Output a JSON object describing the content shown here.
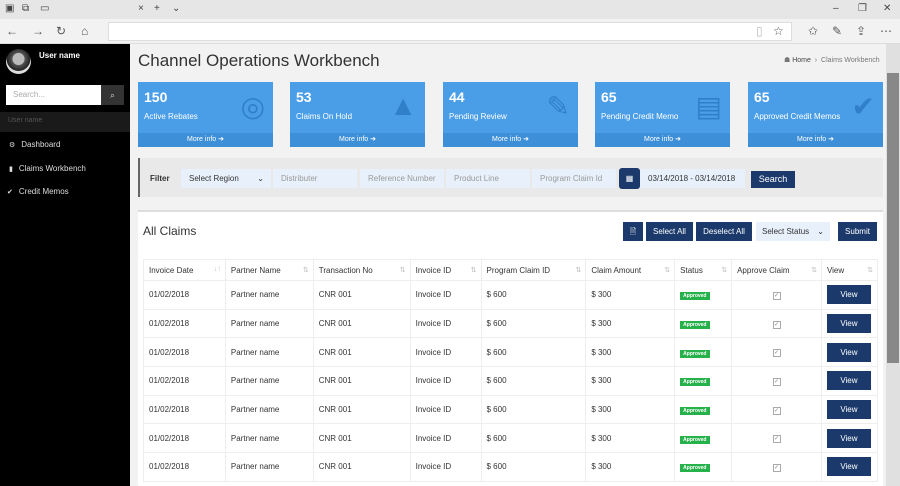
{
  "browser": {
    "tab_icons": [
      "tabs-icon",
      "set-aside-icon",
      "window-icon"
    ],
    "close": "×",
    "new_tab": "+",
    "tab_menu": "⌄",
    "win_min": "–",
    "win_max": "❐",
    "win_close": "✕"
  },
  "sidebar": {
    "username": "User name",
    "search_placeholder": "Search...",
    "section_label": "User name",
    "items": [
      {
        "label": "Dashboard",
        "icon": "dashboard-icon"
      },
      {
        "label": "Claims Workbench",
        "icon": "file-icon"
      },
      {
        "label": "Credit Memos",
        "icon": "check-circle-icon"
      }
    ]
  },
  "header": {
    "title": "Channel Operations Workbench",
    "breadcrumb": [
      "Home",
      "Claims Workbench"
    ]
  },
  "cards": [
    {
      "value": "150",
      "label": "Active Rebates",
      "more": "More info",
      "icon": "life-ring-icon"
    },
    {
      "value": "53",
      "label": "Claims On Hold",
      "more": "More info",
      "icon": "warning-icon"
    },
    {
      "value": "44",
      "label": "Pending Review",
      "more": "More info",
      "icon": "edit-icon"
    },
    {
      "value": "65",
      "label": "Pending Credit Memo",
      "more": "More info",
      "icon": "document-icon"
    },
    {
      "value": "65",
      "label": "Approved Credit Memos",
      "more": "More info",
      "icon": "check-circle-icon"
    }
  ],
  "filter": {
    "label": "Filter",
    "region": "Select Region",
    "distributer": "Distributer",
    "reference": "Reference Number",
    "product": "Product Line",
    "program": "Program Claim Id",
    "date_range": "03/14/2018 - 03/14/2018",
    "search": "Search"
  },
  "claims": {
    "title": "All Claims",
    "select_all": "Select All",
    "deselect_all": "Deselect All",
    "select_status": "Select Status",
    "submit": "Submit",
    "columns": [
      "Invoice Date",
      "Partner Name",
      "Transaction No",
      "Invoice ID",
      "Program Claim ID",
      "Claim Amount",
      "Status",
      "Approve Claim",
      "View"
    ],
    "rows": [
      {
        "date": "01/02/2018",
        "partner": "Partner name",
        "txn": "CNR 001",
        "invoice": "Invoice ID",
        "program": "$ 600",
        "amount": "$ 300",
        "status": "Approved",
        "approved": true,
        "view": "View"
      },
      {
        "date": "01/02/2018",
        "partner": "Partner name",
        "txn": "CNR 001",
        "invoice": "Invoice ID",
        "program": "$ 600",
        "amount": "$ 300",
        "status": "Approved",
        "approved": true,
        "view": "View"
      },
      {
        "date": "01/02/2018",
        "partner": "Partner name",
        "txn": "CNR 001",
        "invoice": "Invoice ID",
        "program": "$ 600",
        "amount": "$ 300",
        "status": "Approved",
        "approved": true,
        "view": "View"
      },
      {
        "date": "01/02/2018",
        "partner": "Partner name",
        "txn": "CNR 001",
        "invoice": "Invoice ID",
        "program": "$ 600",
        "amount": "$ 300",
        "status": "Approved",
        "approved": true,
        "view": "View"
      },
      {
        "date": "01/02/2018",
        "partner": "Partner name",
        "txn": "CNR 001",
        "invoice": "Invoice ID",
        "program": "$ 600",
        "amount": "$ 300",
        "status": "Approved",
        "approved": true,
        "view": "View"
      },
      {
        "date": "01/02/2018",
        "partner": "Partner name",
        "txn": "CNR 001",
        "invoice": "Invoice ID",
        "program": "$ 600",
        "amount": "$ 300",
        "status": "Approved",
        "approved": true,
        "view": "View"
      },
      {
        "date": "01/02/2018",
        "partner": "Partner name",
        "txn": "CNR 001",
        "invoice": "Invoice ID",
        "program": "$ 600",
        "amount": "$ 300",
        "status": "Approved",
        "approved": true,
        "view": "View"
      }
    ]
  },
  "colors": {
    "card": "#4a9ee8",
    "primary": "#1b3a6b",
    "approved": "#27b14b",
    "sidebar": "#000000"
  }
}
